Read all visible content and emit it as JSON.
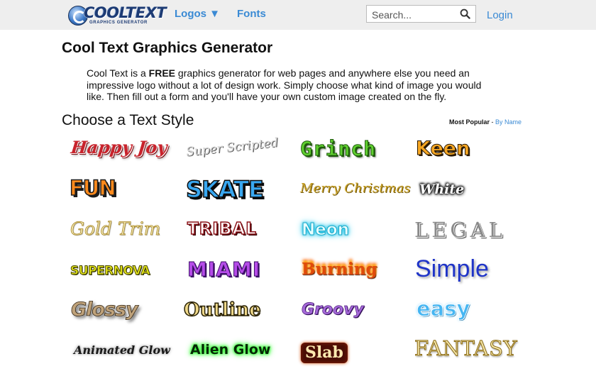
{
  "header": {
    "logo_text": "COOLTEXT",
    "logo_subtitle": "GRAPHICS GENERATOR",
    "nav_logos": "Logos ▼",
    "nav_fonts": "Fonts",
    "search_placeholder": "Search...",
    "login": "Login"
  },
  "main": {
    "title": "Cool Text Graphics Generator",
    "intro_part1": "Cool Text is a ",
    "intro_bold": "FREE",
    "intro_part2": " graphics generator for web pages and anywhere else you need an impressive logo without a lot of design work. Simply choose what kind of image you would like. Then fill out a form and you'll have your own custom image created on the fly.",
    "section_title": "Choose a Text Style",
    "sort_active": "Most Popular",
    "sort_separator": " - ",
    "sort_link": "By Name"
  },
  "styles": [
    {
      "label": "Happy Joy"
    },
    {
      "label": "Super Scripted"
    },
    {
      "label": "Grinch"
    },
    {
      "label": "Keen"
    },
    {
      "label": "FUN"
    },
    {
      "label": "SKATE"
    },
    {
      "label": "Merry Christmas"
    },
    {
      "label": "White"
    },
    {
      "label": "Gold Trim"
    },
    {
      "label": "TRIBAL"
    },
    {
      "label": "Neon"
    },
    {
      "label": "LEGAL"
    },
    {
      "label": "SUPERNOVA"
    },
    {
      "label": "MIAMI"
    },
    {
      "label": "Burning"
    },
    {
      "label": "Simple"
    },
    {
      "label": "Glossy"
    },
    {
      "label": "Outline"
    },
    {
      "label": "Groovy"
    },
    {
      "label": "easy"
    },
    {
      "label": "Animated Glow"
    },
    {
      "label": "Alien Glow"
    },
    {
      "label": "Slab"
    },
    {
      "label": "FANTASY"
    }
  ],
  "colors": {
    "topbar_bg": "#eeeeee",
    "link_blue": "#3a8ad4",
    "logo_navy": "#1d3b74"
  }
}
